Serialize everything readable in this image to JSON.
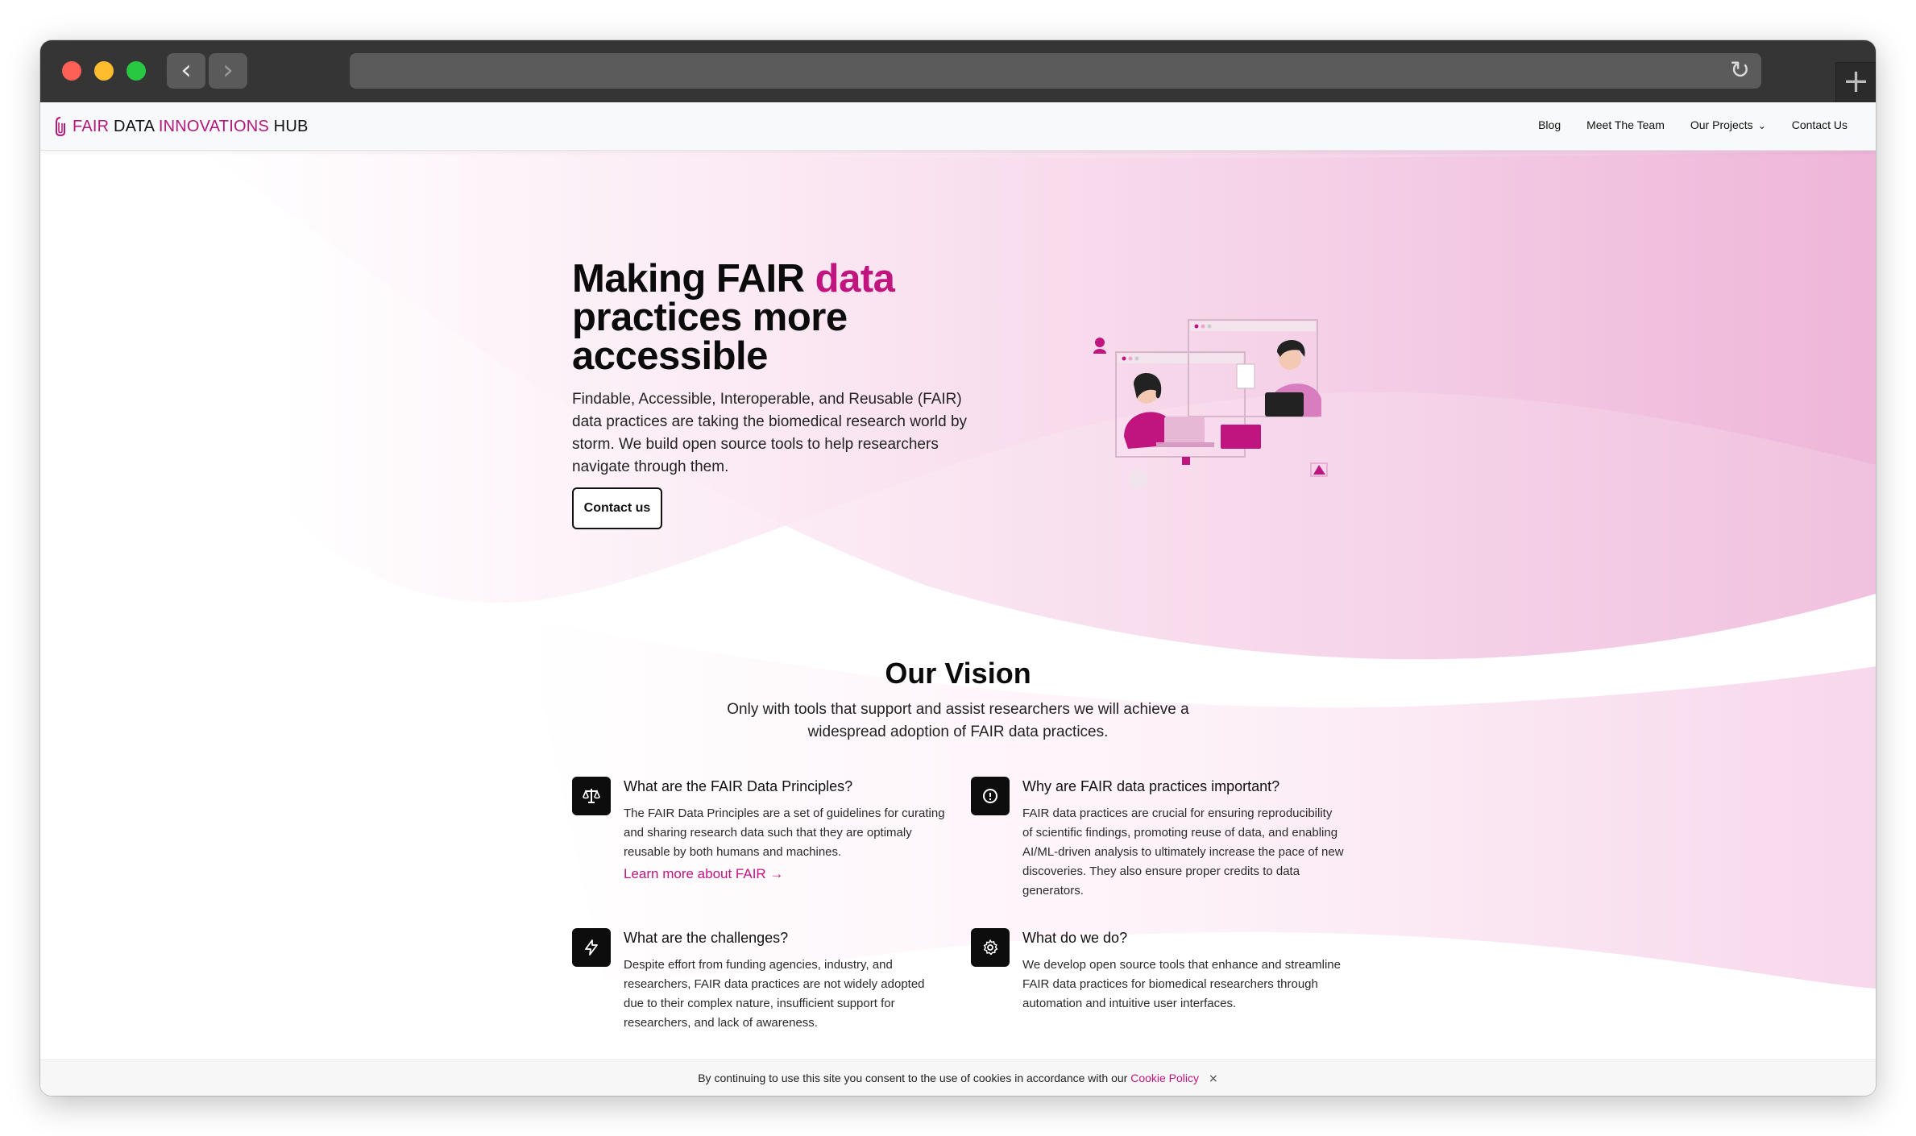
{
  "browser": {
    "back_glyph": "‹",
    "forward_glyph": "›",
    "reload_glyph": "↻",
    "newtab_glyph": "+"
  },
  "header": {
    "logo": {
      "fair": "FAIR",
      "data": "DATA",
      "innovations": "INNOVATIONS",
      "hub": "HUB"
    },
    "nav": {
      "blog": "Blog",
      "team": "Meet The Team",
      "projects": "Our Projects",
      "contact": "Contact Us"
    }
  },
  "hero": {
    "title_part1": "Making FAIR ",
    "title_accent": "data",
    "title_part2": "practices more accessible",
    "description": "Findable, Accessible, Interoperable, and Reusable (FAIR) data practices are taking the biomedical research world by storm. We build open source tools to help researchers navigate through them.",
    "cta": "Contact us"
  },
  "vision": {
    "title": "Our Vision",
    "subtitle_line1": "Only with tools that support and assist researchers we will achieve a",
    "subtitle_line2": "widespread adoption of FAIR data practices.",
    "features": [
      {
        "icon": "scale-icon",
        "title": "What are the FAIR Data Principles?",
        "body": "The FAIR Data Principles are a set of guidelines for curating and sharing research data such that they are optimaly reusable by both humans and machines.",
        "link": "Learn more about FAIR →"
      },
      {
        "icon": "alert-circle-icon",
        "title": "Why are FAIR data practices important?",
        "body": "FAIR data practices are crucial for ensuring reproducibility of scientific findings, promoting reuse of data, and enabling AI/ML-driven analysis to ultimately increase the pace of new discoveries. They also ensure proper credits to data generators."
      },
      {
        "icon": "lightning-icon",
        "title": "What are the challenges?",
        "body": "Despite effort from funding agencies, industry, and researchers, FAIR data practices are not widely adopted due to their complex nature, insufficient support for researchers, and lack of awareness."
      },
      {
        "icon": "gear-icon",
        "title": "What do we do?",
        "body": "We develop open source tools that enhance and streamline FAIR data practices for biomedical researchers through automation and intuitive user interfaces."
      }
    ]
  },
  "cookie": {
    "text": "By continuing to use this site you consent to the use of cookies in accordance with our ",
    "link": "Cookie Policy",
    "close": "×"
  },
  "colors": {
    "accent": "#c0157f",
    "hero_pink": "#f2c8e3",
    "text_dark": "#0b0b0b"
  }
}
